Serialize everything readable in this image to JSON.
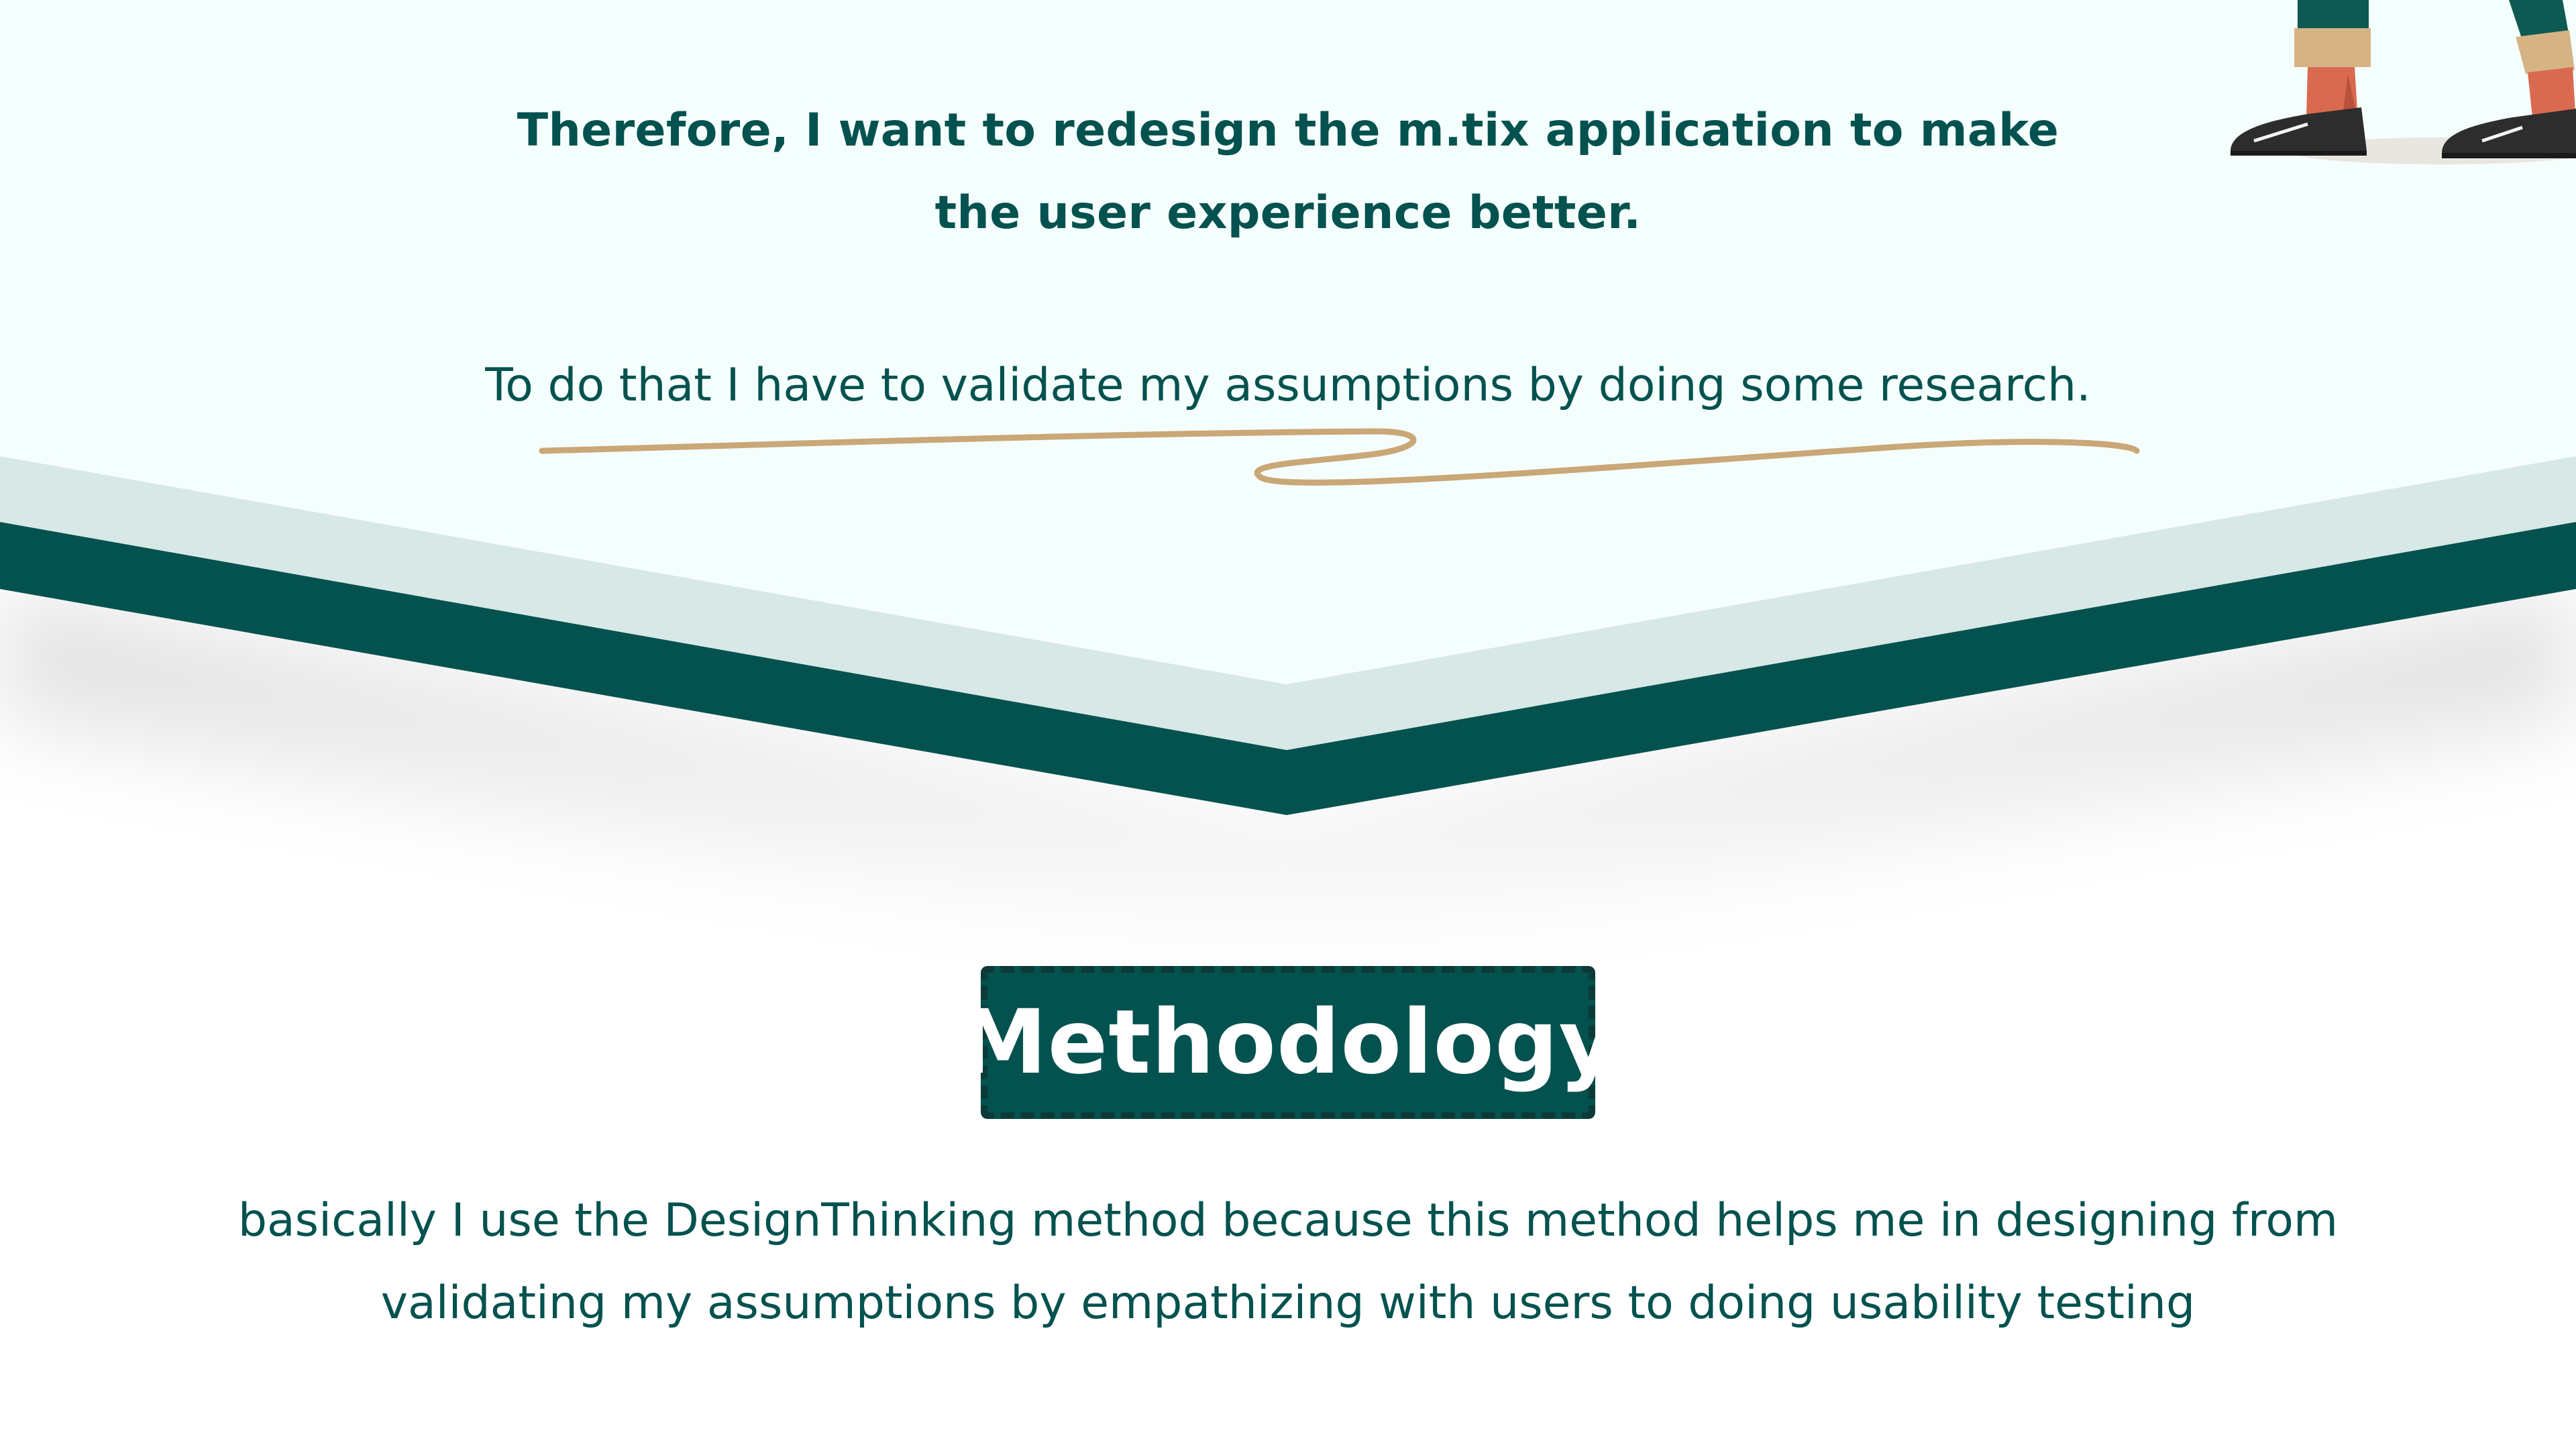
{
  "colors": {
    "brand": "#03524f",
    "panel_bg": "#f4fefd",
    "band_light": "#d7e8e6",
    "squiggle": "#caa777",
    "skin": "#d96a4f",
    "sock": "#d6b384",
    "shoe": "#2d2d2d"
  },
  "intro": {
    "line1": "Therefore, I want to redesign the m.tix application to make",
    "line2": "the user experience better.",
    "line3": "To do that I have to validate my assumptions by doing some research."
  },
  "methodology": {
    "title": "Methodology",
    "body_line1": "basically I use the DesignThinking method because this method helps me in designing from",
    "body_line2": "validating my assumptions by empathizing with users to doing usability testing"
  },
  "decor": {
    "underline": "squiggle-underline",
    "illustration": "person-feet-illustration"
  }
}
